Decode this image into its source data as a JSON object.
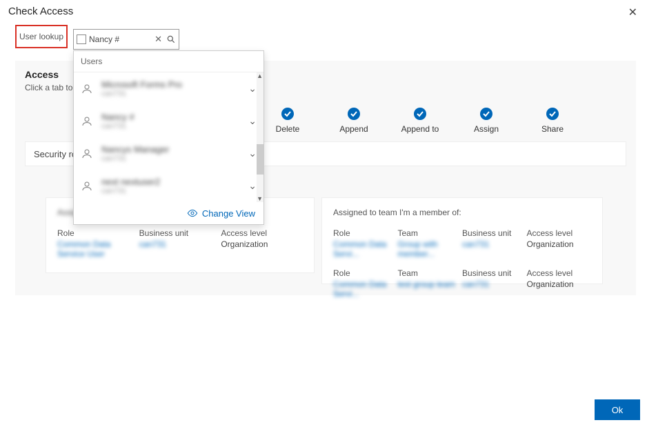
{
  "dialog": {
    "title": "Check Access",
    "close_icon": "close"
  },
  "highlight": {
    "label": "User lookup"
  },
  "lookup": {
    "value": "Nancy #",
    "icon": "user-card",
    "search_icon": "search"
  },
  "dropdown": {
    "header": "Users",
    "items": [
      {
        "name": "Microsoft Forms Pro",
        "sub": "can731"
      },
      {
        "name": "Nancy #",
        "sub": "can731"
      },
      {
        "name": "Nancys Manager",
        "sub": "can731"
      },
      {
        "name": "next nextuser2",
        "sub": "can731"
      }
    ],
    "change_view": "Change View"
  },
  "access": {
    "title": "Access",
    "subtitle": "Click a tab to"
  },
  "permissions": [
    {
      "label": "Delete"
    },
    {
      "label": "Append"
    },
    {
      "label": "Append to"
    },
    {
      "label": "Assign"
    },
    {
      "label": "Share"
    }
  ],
  "tab": {
    "label": "Security rol"
  },
  "panel_left": {
    "title": "Assigned directly:",
    "headers": {
      "role": "Role",
      "bu": "Business unit",
      "al": "Access level"
    },
    "rows": [
      {
        "role": "Common Data Service User",
        "bu": "can731",
        "al": "Organization"
      }
    ]
  },
  "panel_right": {
    "title": "Assigned to team I'm a member of:",
    "headers": {
      "role": "Role",
      "team": "Team",
      "bu": "Business unit",
      "al": "Access level"
    },
    "rows": [
      {
        "role": "Common Data Servi...",
        "team": "Group with member...",
        "bu": "can731",
        "al": "Organization"
      },
      {
        "role": "Common Data Servi...",
        "team": "test group team",
        "bu": "can731",
        "al": "Organization"
      }
    ]
  },
  "ok_button": "Ok"
}
